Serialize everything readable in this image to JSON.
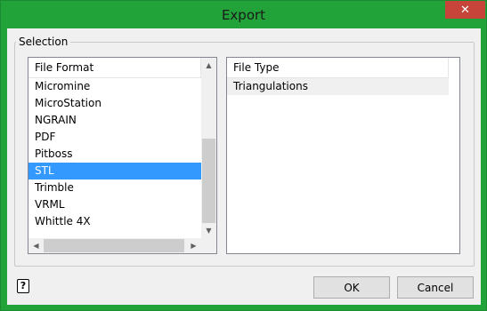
{
  "window": {
    "title": "Export",
    "close_label": "✕"
  },
  "selection": {
    "group_label": "Selection",
    "file_format": {
      "header": "File Format",
      "items": [
        "Micromine",
        "MicroStation",
        "NGRAIN",
        "PDF",
        "Pitboss",
        "STL",
        "Trimble",
        "VRML",
        "Whittle 4X"
      ],
      "selected": "STL"
    },
    "file_type": {
      "header": "File Type",
      "items": [
        "Triangulations"
      ]
    }
  },
  "buttons": {
    "ok": "OK",
    "cancel": "Cancel"
  },
  "help": {
    "label": "?"
  },
  "colors": {
    "titlebar": "#22a33a",
    "close": "#c7443b",
    "selection": "#3399ff"
  }
}
